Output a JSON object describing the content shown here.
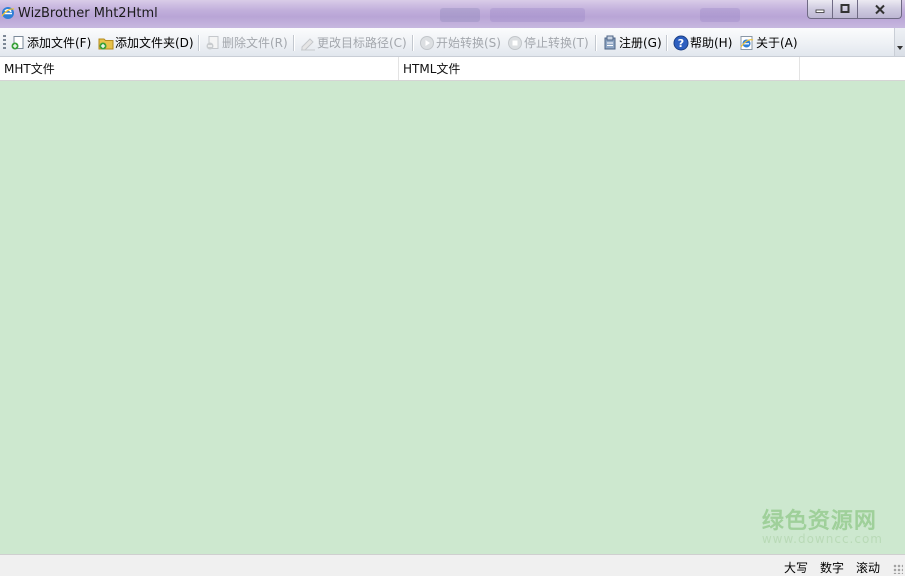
{
  "window": {
    "title": "WizBrother Mht2Html",
    "controls": [
      "minimize",
      "maximize",
      "close"
    ]
  },
  "toolbar": {
    "items": [
      {
        "label": "添加文件(F)",
        "icon": "add-file-icon",
        "enabled": true
      },
      {
        "label": "添加文件夹(D)",
        "icon": "add-folder-icon",
        "enabled": true
      },
      {
        "label": "删除文件(R)",
        "icon": "delete-file-icon",
        "enabled": false
      },
      {
        "label": "更改目标路径(C)",
        "icon": "change-path-icon",
        "enabled": false
      },
      {
        "label": "开始转换(S)",
        "icon": "start-icon",
        "enabled": false
      },
      {
        "label": "停止转换(T)",
        "icon": "stop-icon",
        "enabled": false
      },
      {
        "label": "注册(G)",
        "icon": "register-icon",
        "enabled": true
      },
      {
        "label": "帮助(H)",
        "icon": "help-icon",
        "enabled": true
      },
      {
        "label": "关于(A)",
        "icon": "about-icon",
        "enabled": true
      }
    ]
  },
  "list": {
    "columns": [
      "MHT文件",
      "HTML文件",
      ""
    ],
    "rows": [],
    "background": "#cde8cf"
  },
  "watermark": {
    "title": "绿色资源网",
    "url": "www.downcc.com"
  },
  "statusbar": {
    "caps": "大写",
    "num": "数字",
    "scroll": "滚动"
  },
  "colors": {
    "titlebar": "#c2b0dc",
    "list_bg": "#cde8cf",
    "disabled_text": "#a3a7ad"
  }
}
